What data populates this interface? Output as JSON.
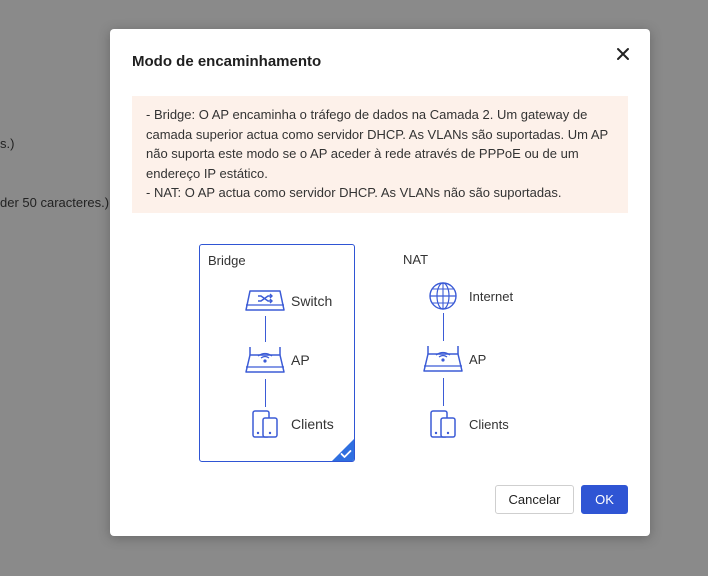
{
  "background": {
    "line1": "s.)",
    "line2": "der 50 caracteres.)"
  },
  "dialog": {
    "title": "Modo de encaminhamento",
    "notice": {
      "bridge_text": "- Bridge: O AP encaminha o tráfego de dados na Camada 2. Um gateway de camada superior actua como servidor DHCP. As VLANs são suportadas. Um AP não suporta este modo se o AP aceder à rede através de PPPoE ou de um endereço IP estático.",
      "nat_text": "- NAT: O AP actua como servidor DHCP. As VLANs não são suportadas."
    },
    "options": {
      "bridge": {
        "label": "Bridge",
        "selected": true,
        "nodes": {
          "top": "Switch",
          "middle": "AP",
          "bottom": "Clients"
        }
      },
      "nat": {
        "label": "NAT",
        "selected": false,
        "nodes": {
          "top": "Internet",
          "middle": "AP",
          "bottom": "Clients"
        }
      }
    },
    "buttons": {
      "cancel": "Cancelar",
      "ok": "OK"
    }
  },
  "colors": {
    "accent": "#2f55d4",
    "notice_bg": "#fdf1ea",
    "overlay": "#8a8a8a"
  }
}
